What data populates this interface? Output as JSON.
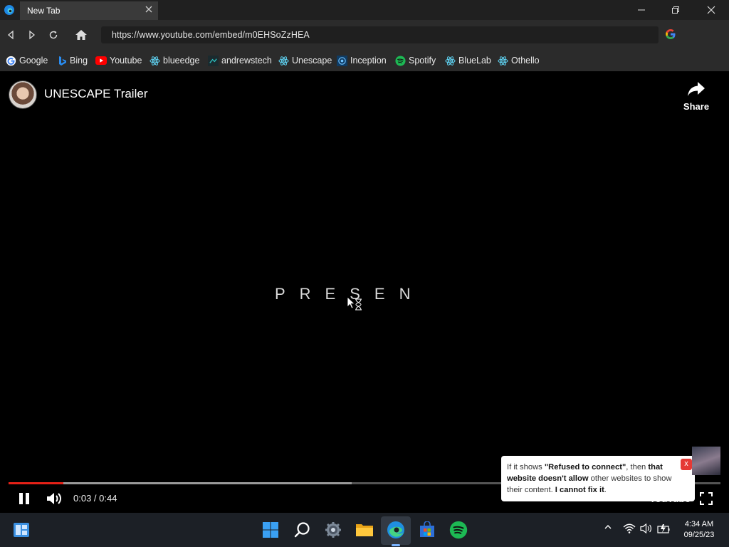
{
  "browser": {
    "tab_title": "New Tab",
    "url": "https://www.youtube.com/embed/m0EHSoZzHEA"
  },
  "bookmarks": [
    {
      "label": "Google",
      "icon": "google-icon"
    },
    {
      "label": "Bing",
      "icon": "bing-icon"
    },
    {
      "label": "Youtube",
      "icon": "youtube-icon"
    },
    {
      "label": "blueedge",
      "icon": "react-icon"
    },
    {
      "label": "andrewstech",
      "icon": "andrewstech-icon"
    },
    {
      "label": "Unescape",
      "icon": "react-icon"
    },
    {
      "label": "Inception",
      "icon": "inception-icon"
    },
    {
      "label": "Spotify",
      "icon": "spotify-icon"
    },
    {
      "label": "BlueLab",
      "icon": "react-icon"
    },
    {
      "label": "Othello",
      "icon": "react-icon"
    }
  ],
  "video": {
    "title": "UNESCAPE Trailer",
    "share_label": "Share",
    "frame_text": "PRESEN",
    "time": "0:03 / 0:44",
    "played_fraction": 0.077,
    "buffered_fraction": 0.482,
    "youtube_label": "YouTube"
  },
  "notice": {
    "t1": "If it shows ",
    "t2": "\"Refused to connect\"",
    "t3": ", then ",
    "t4": "that website doesn't allow",
    "t5": " other websites to show their content. ",
    "t6": "I cannot fix it",
    "t7": ".",
    "close_label": "x"
  },
  "taskbar": {
    "time": "4:34 AM",
    "date": "09/25/23"
  },
  "colors": {
    "accent_red": "#e62117",
    "edge_blue": "#3aa0f3",
    "spotify_green": "#1db954"
  }
}
